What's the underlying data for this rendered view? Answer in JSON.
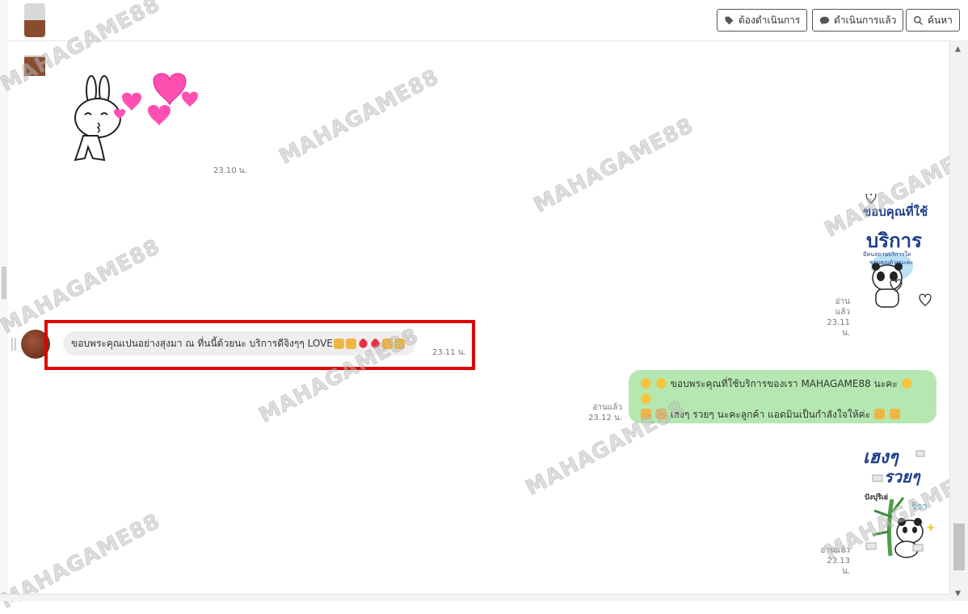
{
  "toolbar": {
    "todo_label": "ต้องดำเนินการ",
    "done_label": "ดำเนินการแล้ว",
    "search_label": "ค้นหา"
  },
  "watermark": "MAHAGAME88",
  "messages": [
    {
      "type": "sticker",
      "direction": "in",
      "time": "23.10 น."
    },
    {
      "type": "sticker",
      "direction": "out",
      "read": "อ่านแล้ว",
      "time": "23.11 น.",
      "sticker_text": [
        "ขอบคุณที่ใช้",
        "บริการ",
        "มีคนสถานบริการใด",
        "ขอบคุณด้วยนะคะ"
      ]
    },
    {
      "type": "text",
      "direction": "in",
      "text": "ขอบพระคุณเปนอย่างสุงมา ณ ที่นนี้ด้วยนะ บริการดีจิงๆๆ  LOVE",
      "time": "23.11 น."
    },
    {
      "type": "text",
      "direction": "out",
      "read": "อ่านแล้ว",
      "time": "23.12 น.",
      "line1": "ขอบพระคุณที่ใช้บริการของเรา MAHAGAME88 นะคะ",
      "line2": "เฮงๆ รวยๆ นะคะลูกค้า แอดมินเป็นกำลังใจให้ค่ะ"
    },
    {
      "type": "sticker",
      "direction": "out",
      "read": "อ่านแล้ว",
      "time": "23.13 น.",
      "sticker_text": [
        "เฮงๆ",
        "รวยๆ",
        "ปังปุริเย่",
        "ริรา"
      ]
    }
  ],
  "colors": {
    "highlight": "#e00000",
    "out_bubble": "#b5e8b0",
    "in_bubble": "#eeeeee",
    "heart": "#ff4fb0"
  }
}
